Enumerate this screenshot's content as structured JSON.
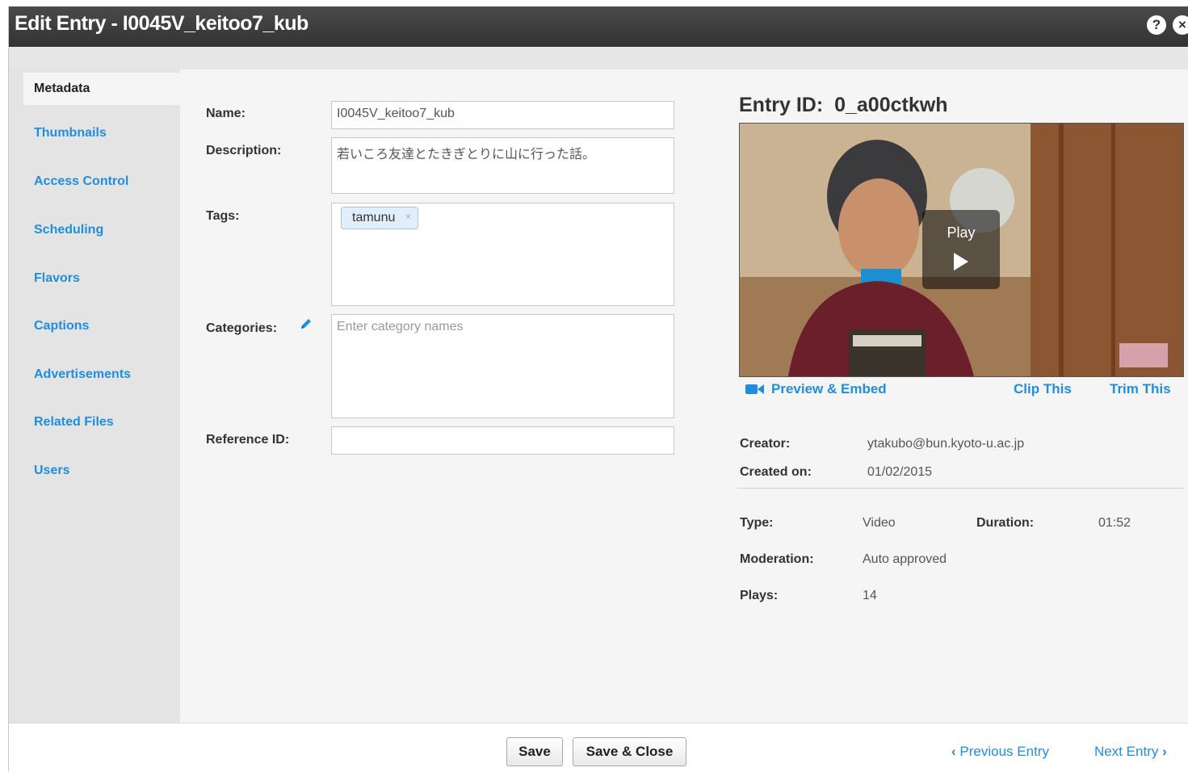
{
  "window": {
    "title": "Edit Entry - I0045V_keitoo7_kub"
  },
  "titlebar_icons": {
    "help": "?",
    "close": "×"
  },
  "sidebar": {
    "active": "Metadata",
    "items": [
      {
        "label": "Thumbnails"
      },
      {
        "label": "Access Control"
      },
      {
        "label": "Scheduling"
      },
      {
        "label": "Flavors"
      },
      {
        "label": "Captions"
      },
      {
        "label": "Advertisements"
      },
      {
        "label": "Related Files"
      },
      {
        "label": "Users"
      }
    ]
  },
  "form": {
    "name_label": "Name:",
    "name_value": "I0045V_keitoo7_kub",
    "description_label": "Description:",
    "description_value": "若いころ友達とたきぎとりに山に行った話。",
    "tags_label": "Tags:",
    "tags": [
      {
        "label": "tamunu",
        "remove": "×"
      }
    ],
    "categories_label": "Categories:",
    "categories_placeholder": "Enter category names",
    "reference_label": "Reference ID:",
    "reference_value": ""
  },
  "entry": {
    "id_label": "Entry ID:",
    "id_value": "0_a00ctkwh",
    "play_label": "Play",
    "preview_embed": "Preview & Embed",
    "clip_this": "Clip This",
    "trim_this": "Trim This",
    "creator_label": "Creator:",
    "creator_value": "ytakubo@bun.kyoto-u.ac.jp",
    "created_label": "Created on:",
    "created_value": "01/02/2015",
    "type_label": "Type:",
    "type_value": "Video",
    "duration_label": "Duration:",
    "duration_value": "01:52",
    "moderation_label": "Moderation:",
    "moderation_value": "Auto approved",
    "plays_label": "Plays:",
    "plays_value": "14"
  },
  "footer": {
    "save": "Save",
    "save_close": "Save & Close",
    "previous": "Previous Entry",
    "next": "Next Entry"
  },
  "colors": {
    "link": "#1f8ee0",
    "titlebar": "#3a3a3a",
    "sidebar": "#e4e4e4"
  }
}
